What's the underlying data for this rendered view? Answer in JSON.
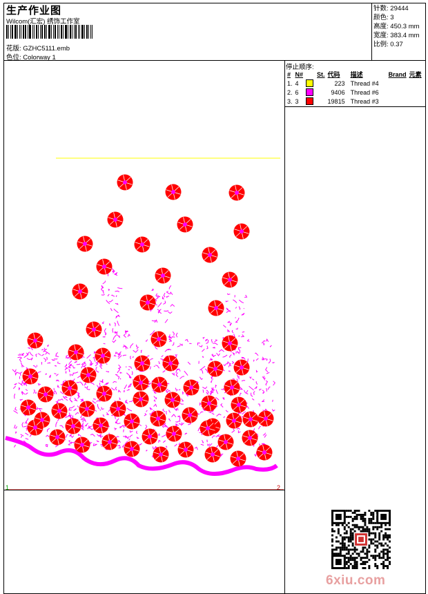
{
  "header": {
    "title": "生产作业图",
    "subtitle": "Wilcom(汇宏) 绣饰工作室",
    "design_label": "花版:",
    "design_value": "GZHC5111.emb",
    "colorway_label": "色位:",
    "colorway_value": "Colorway 1"
  },
  "stats": [
    {
      "label": "针数:",
      "value": "29444"
    },
    {
      "label": "颜色:",
      "value": "3"
    },
    {
      "label": "高度:",
      "value": "450.3 mm"
    },
    {
      "label": "宽度:",
      "value": "383.4 mm"
    },
    {
      "label": "比例:",
      "value": "0.37"
    }
  ],
  "stop_sequence": {
    "heading": "停止顺序:",
    "columns": [
      "#",
      "N#",
      "St.",
      "代码",
      "描述",
      "Brand",
      "元素"
    ],
    "rows": [
      {
        "index": "1.",
        "n": "4",
        "color": "#ffff00",
        "stitches": "223",
        "desc": "Thread #4"
      },
      {
        "index": "2.",
        "n": "6",
        "color": "#ff00ff",
        "stitches": "9406",
        "desc": "Thread #6"
      },
      {
        "index": "3.",
        "n": "3",
        "color": "#ff0000",
        "stitches": "19815",
        "desc": "Thread #3"
      }
    ]
  },
  "markers": {
    "start": "1",
    "end": "2"
  },
  "watermark": "6xiu.com",
  "colors": {
    "yellow": "#ffff00",
    "magenta": "#ff00ff",
    "red": "#ff0000",
    "start_green": "#00a000"
  },
  "icons": {
    "qr": "qr-code-icon",
    "barcode": "barcode-icon"
  }
}
